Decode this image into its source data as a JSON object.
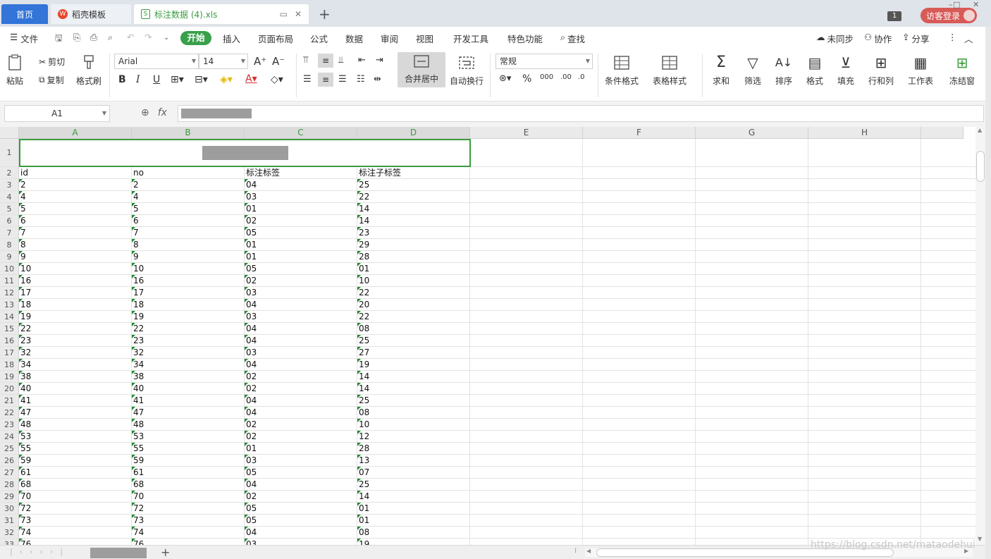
{
  "tabs": {
    "home": "首页",
    "template": "稻壳模板",
    "file": "标注数据 (4).xls",
    "add": "+",
    "template_icon": "wps-logo",
    "file_icon": "spreadsheet-s-icon"
  },
  "window": {
    "count": "1",
    "login": "访客登录"
  },
  "menu": {
    "file": "文件",
    "start": "开始",
    "items": [
      "插入",
      "页面布局",
      "公式",
      "数据",
      "审阅",
      "视图",
      "开发工具",
      "特色功能"
    ],
    "search": "查找",
    "sync": "未同步",
    "collab": "协作",
    "share": "分享"
  },
  "ribbon": {
    "paste": "粘贴",
    "cut": "剪切",
    "copy": "复制",
    "format_painter": "格式刷",
    "font_name": "Arial",
    "font_size": "14",
    "merge_center": "合并居中",
    "wrap_text": "自动换行",
    "number_format": "常规",
    "cond_format": "条件格式",
    "table_style": "表格样式",
    "sum": "求和",
    "filter": "筛选",
    "sort": "排序",
    "format": "格式",
    "fill": "填充",
    "row_col": "行和列",
    "worksheet": "工作表",
    "freeze": "冻结窗"
  },
  "formula_bar": {
    "name_box": "A1",
    "fx": "fx"
  },
  "sheet": {
    "columns": [
      "A",
      "B",
      "C",
      "D",
      "E",
      "F",
      "G",
      "H"
    ],
    "header_row": [
      "id",
      "no",
      "标注标签",
      "标注子标签"
    ],
    "rows": [
      [
        "2",
        "2",
        "04",
        "25"
      ],
      [
        "4",
        "4",
        "03",
        "22"
      ],
      [
        "5",
        "5",
        "01",
        "14"
      ],
      [
        "6",
        "6",
        "02",
        "14"
      ],
      [
        "7",
        "7",
        "05",
        "23"
      ],
      [
        "8",
        "8",
        "01",
        "29"
      ],
      [
        "9",
        "9",
        "01",
        "28"
      ],
      [
        "10",
        "10",
        "05",
        "01"
      ],
      [
        "16",
        "16",
        "02",
        "10"
      ],
      [
        "17",
        "17",
        "03",
        "22"
      ],
      [
        "18",
        "18",
        "04",
        "20"
      ],
      [
        "19",
        "19",
        "03",
        "22"
      ],
      [
        "22",
        "22",
        "04",
        "08"
      ],
      [
        "23",
        "23",
        "04",
        "25"
      ],
      [
        "32",
        "32",
        "03",
        "27"
      ],
      [
        "34",
        "34",
        "04",
        "19"
      ],
      [
        "38",
        "38",
        "02",
        "14"
      ],
      [
        "40",
        "40",
        "02",
        "14"
      ],
      [
        "41",
        "41",
        "04",
        "25"
      ],
      [
        "47",
        "47",
        "04",
        "08"
      ],
      [
        "48",
        "48",
        "02",
        "10"
      ],
      [
        "53",
        "53",
        "02",
        "12"
      ],
      [
        "55",
        "55",
        "01",
        "28"
      ],
      [
        "59",
        "59",
        "03",
        "13"
      ],
      [
        "61",
        "61",
        "05",
        "07"
      ],
      [
        "68",
        "68",
        "04",
        "25"
      ],
      [
        "70",
        "70",
        "02",
        "14"
      ],
      [
        "72",
        "72",
        "05",
        "01"
      ],
      [
        "73",
        "73",
        "05",
        "01"
      ],
      [
        "74",
        "74",
        "04",
        "08"
      ],
      [
        "76",
        "76",
        "03",
        "19"
      ]
    ]
  },
  "watermark": "https://blog.csdn.net/mataodehui"
}
